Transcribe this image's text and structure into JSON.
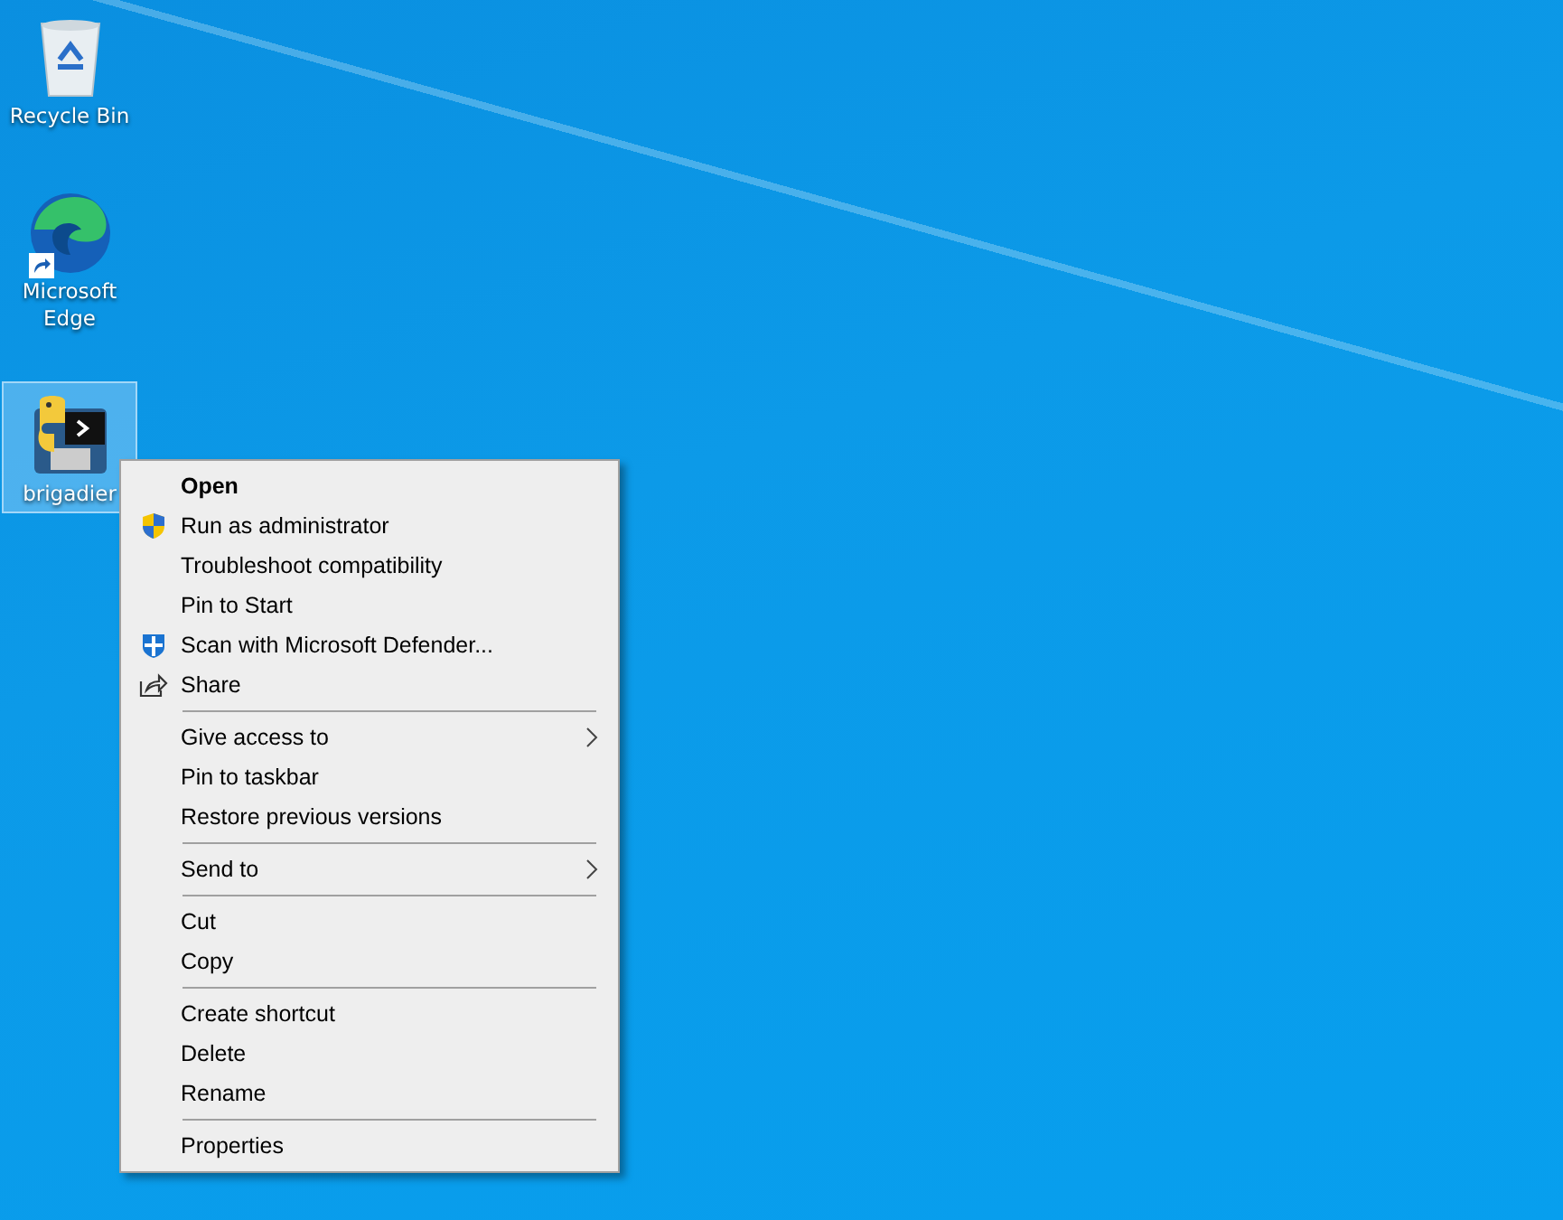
{
  "desktop_icons": [
    {
      "label": "Recycle Bin",
      "kind": "recycle",
      "selected": false,
      "shortcut": false
    },
    {
      "label": "Microsoft Edge",
      "kind": "browser",
      "selected": false,
      "shortcut": true
    },
    {
      "label": "brigadier",
      "kind": "app",
      "selected": true,
      "shortcut": false
    }
  ],
  "context_menu": {
    "groups": [
      [
        {
          "label": "Open",
          "default": true
        },
        {
          "label": "Run as administrator",
          "kind": "shield"
        },
        {
          "label": "Troubleshoot compatibility"
        },
        {
          "label": "Pin to Start"
        },
        {
          "label": "Scan with Microsoft Defender...",
          "kind": "defender"
        },
        {
          "label": "Share",
          "kind": "share"
        }
      ],
      [
        {
          "label": "Give access to",
          "submenu": true
        },
        {
          "label": "Pin to taskbar"
        },
        {
          "label": "Restore previous versions"
        }
      ],
      [
        {
          "label": "Send to",
          "submenu": true
        }
      ],
      [
        {
          "label": "Cut"
        },
        {
          "label": "Copy"
        }
      ],
      [
        {
          "label": "Create shortcut"
        },
        {
          "label": "Delete"
        },
        {
          "label": "Rename"
        }
      ],
      [
        {
          "label": "Properties"
        }
      ]
    ]
  }
}
